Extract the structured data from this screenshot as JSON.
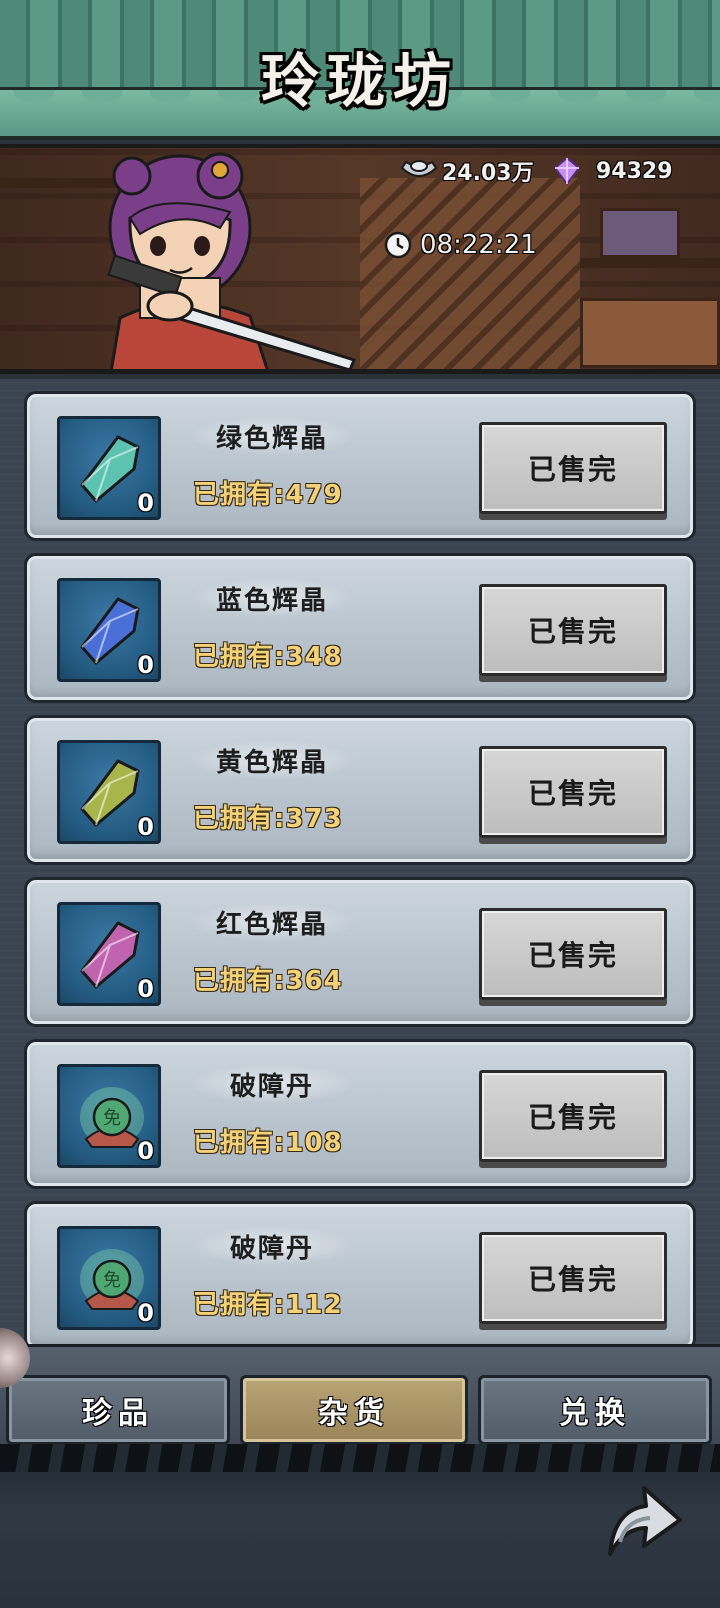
{
  "header": {
    "title": "玲珑坊"
  },
  "banner": {
    "silver": {
      "icon": "silver-ingot-icon",
      "value": "24.03万"
    },
    "gem": {
      "icon": "purple-gem-icon",
      "value": "94329"
    },
    "timer": {
      "icon": "clock-icon",
      "value": "08:22:21"
    }
  },
  "items": [
    {
      "name": "绿色辉晶",
      "owned": "已拥有:479",
      "qty": "0",
      "button": "已售完",
      "icon": "green-crystal-icon",
      "color": "#5cc3b0"
    },
    {
      "name": "蓝色辉晶",
      "owned": "已拥有:348",
      "qty": "0",
      "button": "已售完",
      "icon": "blue-crystal-icon",
      "color": "#4a6fd6"
    },
    {
      "name": "黄色辉晶",
      "owned": "已拥有:373",
      "qty": "0",
      "button": "已售完",
      "icon": "yellow-crystal-icon",
      "color": "#a8b54a"
    },
    {
      "name": "红色辉晶",
      "owned": "已拥有:364",
      "qty": "0",
      "button": "已售完",
      "icon": "red-crystal-icon",
      "color": "#c064b0"
    },
    {
      "name": "破障丹",
      "owned": "已拥有:108",
      "qty": "0",
      "button": "已售完",
      "icon": "pill-icon",
      "color": "#4fa874"
    },
    {
      "name": "破障丹",
      "owned": "已拥有:112",
      "qty": "0",
      "button": "已售完",
      "icon": "pill-icon",
      "color": "#4fa874"
    }
  ],
  "tabs": [
    {
      "label": "珍品",
      "active": false
    },
    {
      "label": "杂货",
      "active": true
    },
    {
      "label": "兑换",
      "active": false
    }
  ],
  "pill_char": "免"
}
